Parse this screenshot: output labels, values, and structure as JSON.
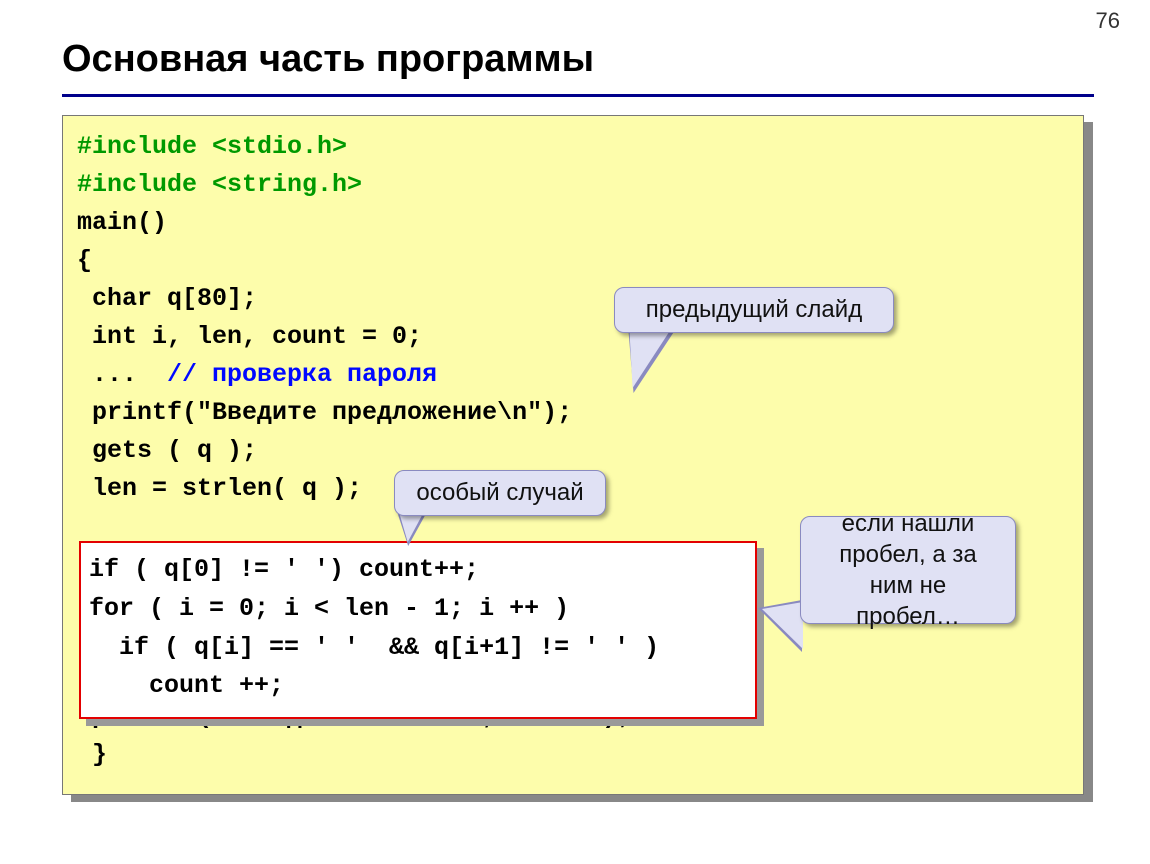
{
  "pageNumber": "76",
  "title": "Основная часть программы",
  "code": {
    "l1a": "#include <stdio.h>",
    "l2a": "#include <string.h>",
    "l3": "main()",
    "l4": "{",
    "l5": " char q[80];",
    "l6": " int i, len, count = 0;",
    "l7a": " ...  ",
    "l7b": "// проверка пароля",
    "l8": " printf(\"Введите предложение\\n\");",
    "l9": " gets ( q );",
    "l10": " len = strlen( q );",
    "gap": "",
    "l15": " printf ( \"Найдено %d слов\", count );",
    "l16": " }"
  },
  "inner": {
    "l1": "if ( q[0] != ' ') count++;",
    "l2": "for ( i = 0; i < len - 1; i ++ )",
    "l3": "  if ( q[i] == ' '  && q[i+1] != ' ' )",
    "l4": "    count ++;"
  },
  "callouts": {
    "c1": "предыдущий слайд",
    "c2": "особый случай",
    "c3": "если нашли пробел, а за ним не пробел…"
  }
}
